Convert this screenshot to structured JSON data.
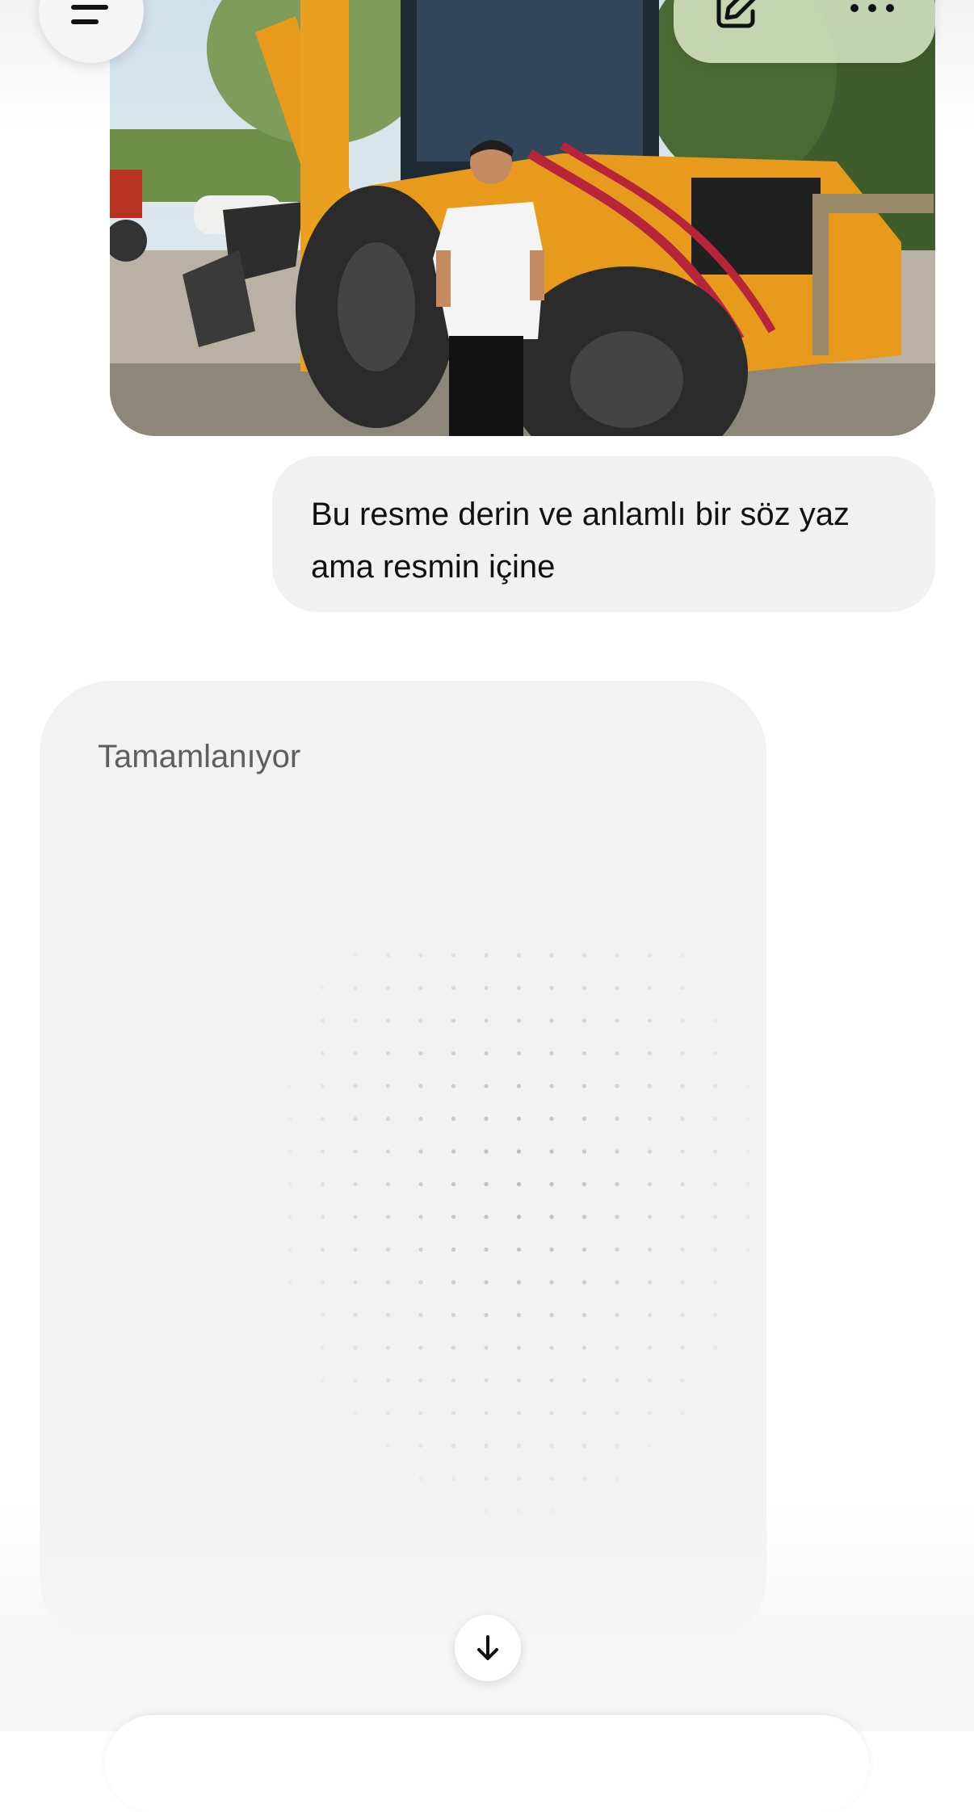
{
  "header": {
    "menu_icon": "menu-icon",
    "edit_icon": "new-chat-icon",
    "more_icon": "more-options-icon"
  },
  "conversation": {
    "user_photo": {
      "description_icon": "uploaded-photo"
    },
    "user_message": "Bu resme derin ve anlamlı bir söz yaz ama resmin içine",
    "assistant_image": {
      "status": "Tamamlanıyor"
    }
  },
  "scroll_button_icon": "arrow-down-icon",
  "colors": {
    "bubble": "#f1f1f1",
    "card": "#f2f2f2",
    "pill": "#d6e4c4",
    "machine": "#e89a1c"
  }
}
